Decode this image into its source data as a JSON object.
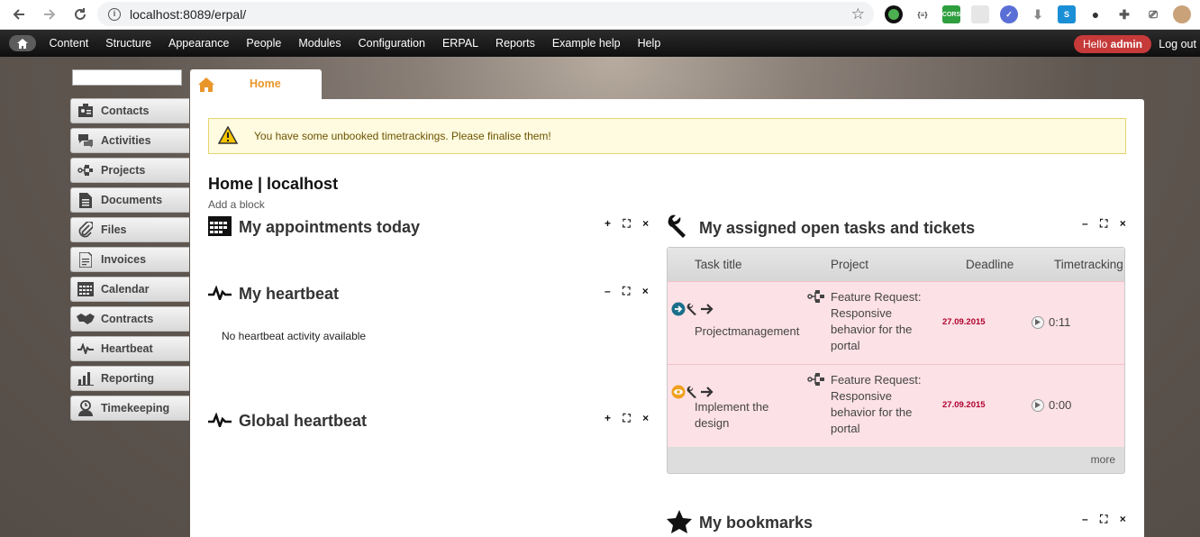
{
  "browser": {
    "url": "localhost:8089/erpal/"
  },
  "toolbar": {
    "items": [
      "Content",
      "Structure",
      "Appearance",
      "People",
      "Modules",
      "Configuration",
      "ERPAL",
      "Reports",
      "Example help",
      "Help"
    ],
    "hello_prefix": "Hello ",
    "hello_user": "admin",
    "logout": "Log out"
  },
  "sidebar": {
    "items": [
      {
        "label": "Contacts",
        "icon": "contacts-icon"
      },
      {
        "label": "Activities",
        "icon": "activities-icon"
      },
      {
        "label": "Projects",
        "icon": "projects-icon"
      },
      {
        "label": "Documents",
        "icon": "documents-icon"
      },
      {
        "label": "Files",
        "icon": "files-icon"
      },
      {
        "label": "Invoices",
        "icon": "invoices-icon"
      },
      {
        "label": "Calendar",
        "icon": "calendar-icon"
      },
      {
        "label": "Contracts",
        "icon": "contracts-icon"
      },
      {
        "label": "Heartbeat",
        "icon": "heartbeat-icon"
      },
      {
        "label": "Reporting",
        "icon": "reporting-icon"
      },
      {
        "label": "Timekeeping",
        "icon": "timekeeping-icon"
      }
    ]
  },
  "tab": {
    "label": "Home"
  },
  "warning": {
    "text": "You have some unbooked timetrackings. Please finalise them!"
  },
  "page": {
    "title": "Home | localhost",
    "add_block": "Add a block"
  },
  "blocks": {
    "appointments": {
      "title": "My appointments today",
      "controls": "+ ⛶ ×"
    },
    "my_heartbeat": {
      "title": "My heartbeat",
      "controls": "– ⛶ ×",
      "empty": "No heartbeat activity available"
    },
    "global_heartbeat": {
      "title": "Global heartbeat",
      "controls": "+ ⛶ ×"
    },
    "tasks": {
      "title": "My assigned open tasks and tickets",
      "controls": "– ⛶ ×",
      "columns": [
        "Task title",
        "Project",
        "Deadline",
        "Timetracking"
      ],
      "rows": [
        {
          "title": "Projectmanagement",
          "project": "Feature Request: Responsive behavior for the portal",
          "deadline": "27.09.2015",
          "time": "0:11",
          "status_color": "#1b6f8a"
        },
        {
          "title": "Implement the design",
          "project": "Feature Request: Responsive behavior for the portal",
          "deadline": "27.09.2015",
          "time": "0:00",
          "status_color": "#f0a020"
        }
      ],
      "more": "more"
    },
    "bookmarks": {
      "title": "My bookmarks",
      "controls": "– ⛶ ×"
    }
  },
  "colors": {
    "accent_orange": "#e8962a",
    "hello_red": "#c63a3a",
    "deadline_red": "#b0002c",
    "row_pink": "#fce1e6"
  }
}
